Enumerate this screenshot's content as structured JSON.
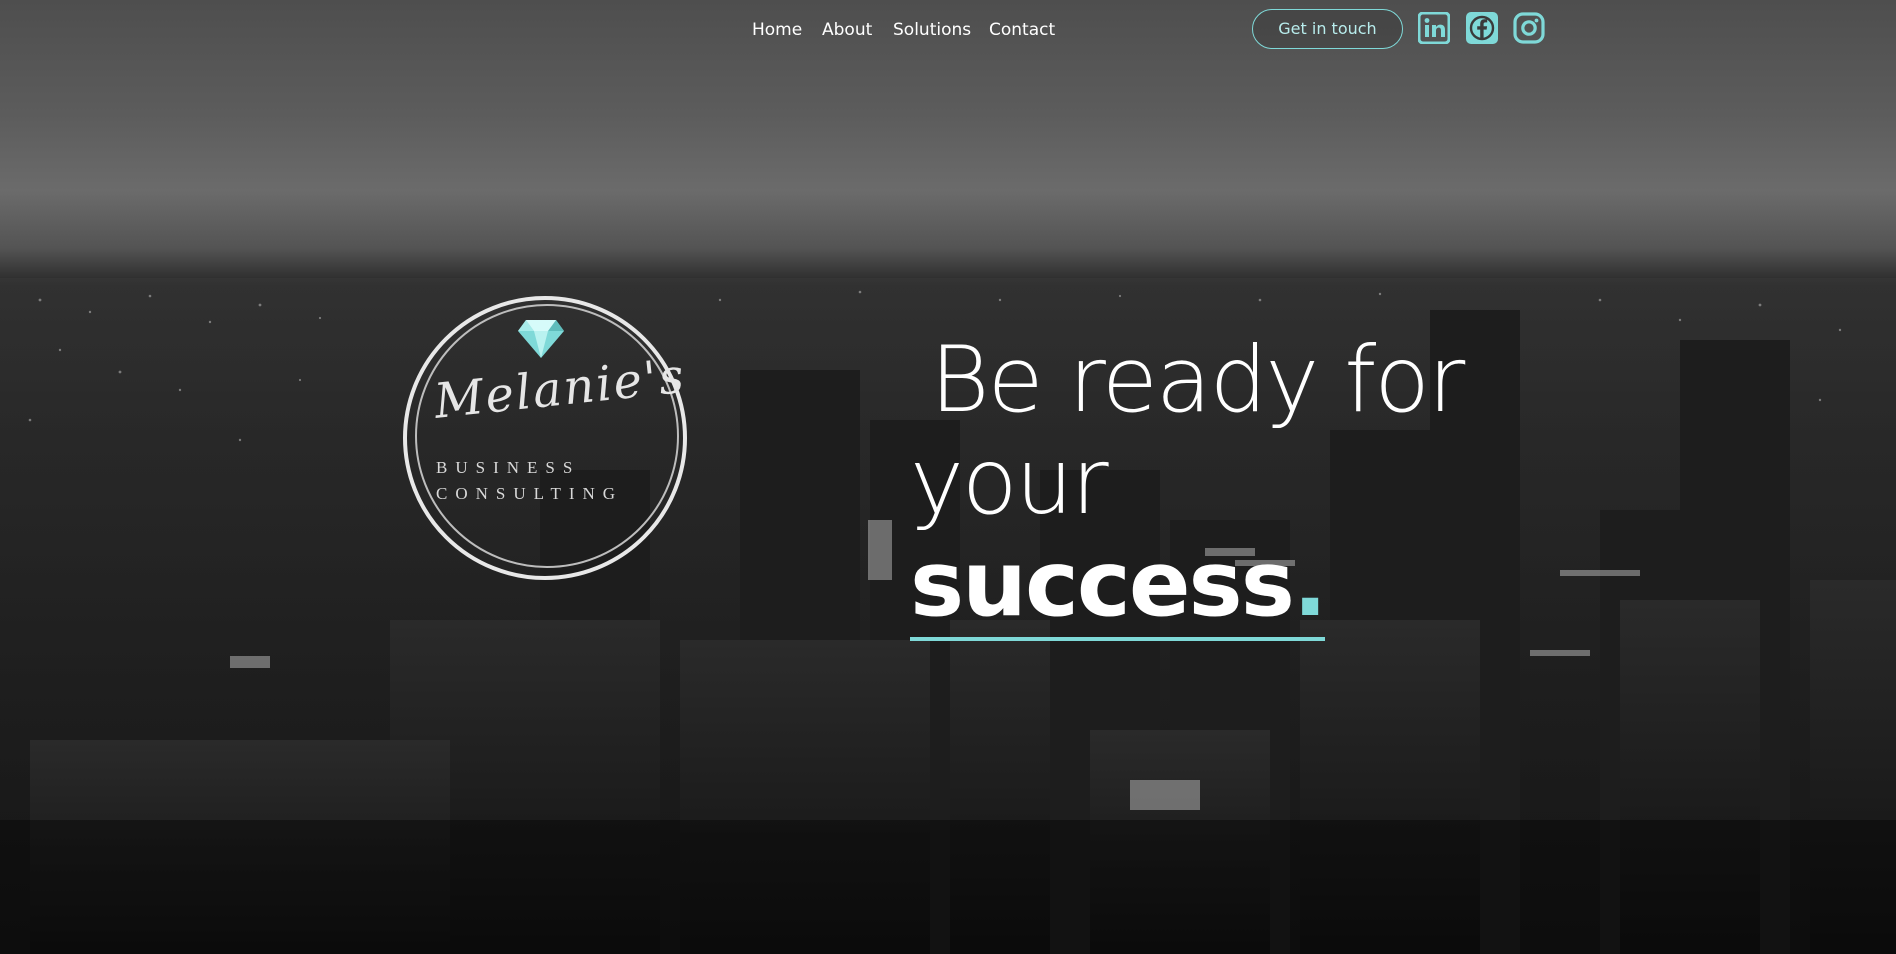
{
  "nav": {
    "items": [
      {
        "label": "Home"
      },
      {
        "label": "About"
      },
      {
        "label": "Solutions"
      },
      {
        "label": "Contact"
      }
    ],
    "cta_label": "Get in touch",
    "social": [
      {
        "icon": "linkedin-icon"
      },
      {
        "icon": "facebook-icon"
      },
      {
        "icon": "instagram-icon"
      }
    ]
  },
  "logo": {
    "script": "Melanie's",
    "line1": "BUSINESS",
    "line2": "CONSULTING",
    "gem_icon": "diamond-icon"
  },
  "hero": {
    "line1": "Be ready for",
    "line2_light": "your ",
    "line2_bold": "success",
    "line2_dot": "."
  },
  "colors": {
    "accent": "#7fd9d8",
    "text": "#ffffff"
  }
}
